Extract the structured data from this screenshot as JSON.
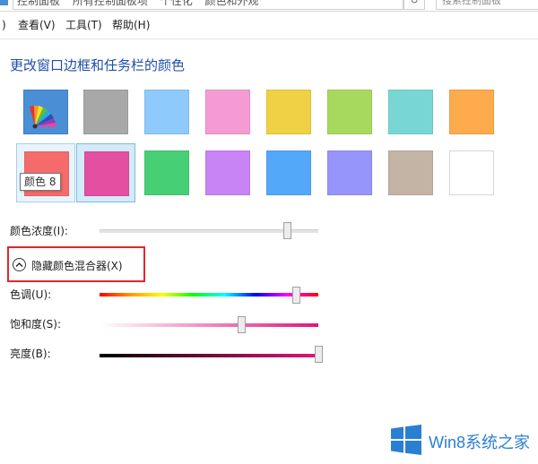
{
  "addressbar": {
    "crumbs": [
      "控制面板",
      "所有控制面板项",
      "个性化",
      "颜色和外观"
    ],
    "search_placeholder": "搜索控制面板"
  },
  "menubar": {
    "items": [
      ")",
      "查看(V)",
      "工具(T)",
      "帮助(H)"
    ]
  },
  "page": {
    "title": "更改窗口边框和任务栏的颜色"
  },
  "swatches": [
    {
      "name": "auto",
      "color": "",
      "icon": "color-fan-icon"
    },
    {
      "name": "gray",
      "color": "#a8a8a8"
    },
    {
      "name": "sky",
      "color": "#8ecafb"
    },
    {
      "name": "pink",
      "color": "#f49bd3"
    },
    {
      "name": "yellow",
      "color": "#f0d044"
    },
    {
      "name": "lime",
      "color": "#a8d95f"
    },
    {
      "name": "teal",
      "color": "#78d7d5"
    },
    {
      "name": "orange",
      "color": "#fdab4d"
    },
    {
      "name": "red",
      "color": "#f56b6b"
    },
    {
      "name": "magenta",
      "color": "#e34fa1"
    },
    {
      "name": "green",
      "color": "#47cf75"
    },
    {
      "name": "violet",
      "color": "#c884f5"
    },
    {
      "name": "blue",
      "color": "#54a8fa"
    },
    {
      "name": "periwinkle",
      "color": "#9695fb"
    },
    {
      "name": "taupe",
      "color": "#c4b4a6"
    },
    {
      "name": "white",
      "color": "#ffffff"
    }
  ],
  "tooltip": "颜色 8",
  "intensity": {
    "label": "颜色浓度(I):",
    "value": 0.86
  },
  "mixer": {
    "label": "隐藏颜色混合器(X)"
  },
  "hue": {
    "label": "色调(U):",
    "value": 0.9
  },
  "saturation": {
    "label": "饱和度(S):",
    "value": 0.65
  },
  "brightness": {
    "label": "亮度(B):",
    "value": 1.0
  },
  "watermark": {
    "text": "Win8系统之家"
  },
  "colors": {
    "accent_title": "#1e4fa8",
    "highlight_border": "#e4262b",
    "selected_swatch": "#e34fa1"
  }
}
